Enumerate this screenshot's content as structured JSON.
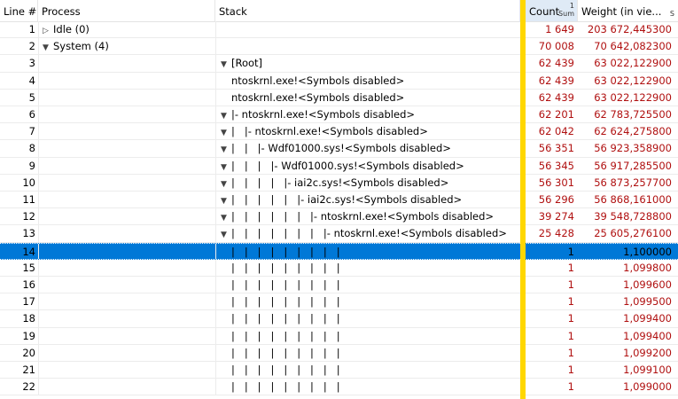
{
  "columns": {
    "line": "Line #",
    "process": "Process",
    "stack": "Stack",
    "count": "Count",
    "count_sort_top": "1",
    "count_sort_sub": "Sum",
    "weight": "Weight (in vie...",
    "weight_sort": "S"
  },
  "colors": {
    "yellow_bar": "#ffd700",
    "selection": "#0078d7",
    "weight_text": "#b01010"
  },
  "rows": [
    {
      "line": "1",
      "process": "Idle (0)",
      "proc_icon": "expand-right",
      "stack": "",
      "count": "1 649",
      "weight": "203 672,445300"
    },
    {
      "line": "2",
      "process": "System (4)",
      "proc_icon": "expand-down",
      "stack": "",
      "count": "70 008",
      "weight": "70 642,082300"
    },
    {
      "line": "3",
      "process": "",
      "stack_icon": "expand-down",
      "stack": "[Root]",
      "count": "62 439",
      "weight": "63 022,122900"
    },
    {
      "line": "4",
      "process": "",
      "stack": "ntoskrnl.exe!<Symbols disabled>",
      "count": "62 439",
      "weight": "63 022,122900"
    },
    {
      "line": "5",
      "process": "",
      "stack": "ntoskrnl.exe!<Symbols disabled>",
      "count": "62 439",
      "weight": "63 022,122900"
    },
    {
      "line": "6",
      "process": "",
      "stack_icon": "expand-down",
      "stack": "|- ntoskrnl.exe!<Symbols disabled>",
      "count": "62 201",
      "weight": "62 783,725500"
    },
    {
      "line": "7",
      "process": "",
      "stack_icon": "expand-down",
      "stack": "|   |- ntoskrnl.exe!<Symbols disabled>",
      "count": "62 042",
      "weight": "62 624,275800"
    },
    {
      "line": "8",
      "process": "",
      "stack_icon": "expand-down",
      "stack": "|   |   |- Wdf01000.sys!<Symbols disabled>",
      "count": "56 351",
      "weight": "56 923,358900"
    },
    {
      "line": "9",
      "process": "",
      "stack_icon": "expand-down",
      "stack": "|   |   |   |- Wdf01000.sys!<Symbols disabled>",
      "count": "56 345",
      "weight": "56 917,285500"
    },
    {
      "line": "10",
      "process": "",
      "stack_icon": "expand-down",
      "stack": "|   |   |   |   |- iai2c.sys!<Symbols disabled>",
      "count": "56 301",
      "weight": "56 873,257700"
    },
    {
      "line": "11",
      "process": "",
      "stack_icon": "expand-down",
      "stack": "|   |   |   |   |   |- iai2c.sys!<Symbols disabled>",
      "count": "56 296",
      "weight": "56 868,161000"
    },
    {
      "line": "12",
      "process": "",
      "stack_icon": "expand-down",
      "stack": "|   |   |   |   |   |   |- ntoskrnl.exe!<Symbols disabled>",
      "count": "39 274",
      "weight": "39 548,728800"
    },
    {
      "line": "13",
      "process": "",
      "stack_icon": "expand-down",
      "stack": "|   |   |   |   |   |   |   |- ntoskrnl.exe!<Symbols disabled>",
      "count": "25 428",
      "weight": "25 605,276100"
    },
    {
      "line": "14",
      "process": "",
      "stack": "|   |   |   |   |   |   |   |   |",
      "count": "1",
      "weight": "1,100000",
      "selected": true
    },
    {
      "line": "15",
      "process": "",
      "stack": "|   |   |   |   |   |   |   |   |",
      "count": "1",
      "weight": "1,099800"
    },
    {
      "line": "16",
      "process": "",
      "stack": "|   |   |   |   |   |   |   |   |",
      "count": "1",
      "weight": "1,099600"
    },
    {
      "line": "17",
      "process": "",
      "stack": "|   |   |   |   |   |   |   |   |",
      "count": "1",
      "weight": "1,099500"
    },
    {
      "line": "18",
      "process": "",
      "stack": "|   |   |   |   |   |   |   |   |",
      "count": "1",
      "weight": "1,099400"
    },
    {
      "line": "19",
      "process": "",
      "stack": "|   |   |   |   |   |   |   |   |",
      "count": "1",
      "weight": "1,099400"
    },
    {
      "line": "20",
      "process": "",
      "stack": "|   |   |   |   |   |   |   |   |",
      "count": "1",
      "weight": "1,099200"
    },
    {
      "line": "21",
      "process": "",
      "stack": "|   |   |   |   |   |   |   |   |",
      "count": "1",
      "weight": "1,099100"
    },
    {
      "line": "22",
      "process": "",
      "stack": "|   |   |   |   |   |   |   |   |",
      "count": "1",
      "weight": "1,099000"
    }
  ]
}
